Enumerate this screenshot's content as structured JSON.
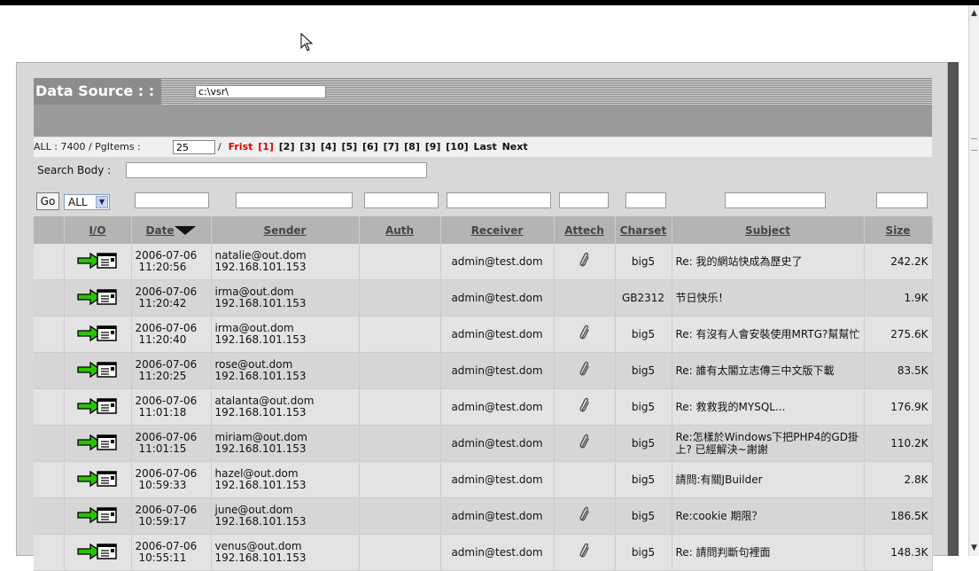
{
  "data_source": {
    "label": "Data Source : :",
    "path": "c:\\vsr\\"
  },
  "pagination": {
    "summary_prefix": "ALL : 7400 / PgItems :",
    "page_items": "25",
    "separator": "/",
    "first_label": "Frist",
    "current_page": "[1]",
    "pages": [
      "[2]",
      "[3]",
      "[4]",
      "[5]",
      "[6]",
      "[7]",
      "[8]",
      "[9]",
      "[10]"
    ],
    "last_label": "Last",
    "next_label": "Next"
  },
  "search": {
    "label": "Search Body :",
    "value": ""
  },
  "filters": {
    "go_label": "Go",
    "io_select": "ALL"
  },
  "columns": {
    "io": "I/O",
    "date": "Date",
    "sender": "Sender",
    "auth": "Auth",
    "receiver": "Receiver",
    "attach": "Attech",
    "charset": "Charset",
    "subject": "Subject",
    "size": "Size"
  },
  "rows": [
    {
      "date": "2006-07-06",
      "time": "11:20:56",
      "sender": "natalie@out.dom",
      "ip": "192.168.101.153",
      "auth": "",
      "receiver": "admin@test.dom",
      "attach": true,
      "charset": "big5",
      "subject": "Re: 我的網站快成為歷史了",
      "size": "242.2K"
    },
    {
      "date": "2006-07-06",
      "time": "11:20:42",
      "sender": "irma@out.dom",
      "ip": "192.168.101.153",
      "auth": "",
      "receiver": "admin@test.dom",
      "attach": false,
      "charset": "GB2312",
      "subject": "节日快乐！",
      "size": "1.9K"
    },
    {
      "date": "2006-07-06",
      "time": "11:20:40",
      "sender": "irma@out.dom",
      "ip": "192.168.101.153",
      "auth": "",
      "receiver": "admin@test.dom",
      "attach": true,
      "charset": "big5",
      "subject": "Re: 有沒有人會安裝使用MRTG?幫幫忙",
      "size": "275.6K"
    },
    {
      "date": "2006-07-06",
      "time": "11:20:25",
      "sender": "rose@out.dom",
      "ip": "192.168.101.153",
      "auth": "",
      "receiver": "admin@test.dom",
      "attach": true,
      "charset": "big5",
      "subject": "Re: 誰有太閣立志傳三中文版下載",
      "size": "83.5K"
    },
    {
      "date": "2006-07-06",
      "time": "11:01:18",
      "sender": "atalanta@out.dom",
      "ip": "192.168.101.153",
      "auth": "",
      "receiver": "admin@test.dom",
      "attach": true,
      "charset": "big5",
      "subject": "Re: 救救我的MYSQL...",
      "size": "176.9K"
    },
    {
      "date": "2006-07-06",
      "time": "11:01:15",
      "sender": "miriam@out.dom",
      "ip": "192.168.101.153",
      "auth": "",
      "receiver": "admin@test.dom",
      "attach": true,
      "charset": "big5",
      "subject": "Re:怎樣於Windows下把PHP4的GD掛上? 已經解決~謝謝",
      "size": "110.2K"
    },
    {
      "date": "2006-07-06",
      "time": "10:59:33",
      "sender": "hazel@out.dom",
      "ip": "192.168.101.153",
      "auth": "",
      "receiver": "admin@test.dom",
      "attach": false,
      "charset": "big5",
      "subject": "請問:有關JBuilder",
      "size": "2.8K"
    },
    {
      "date": "2006-07-06",
      "time": "10:59:17",
      "sender": "june@out.dom",
      "ip": "192.168.101.153",
      "auth": "",
      "receiver": "admin@test.dom",
      "attach": true,
      "charset": "big5",
      "subject": "Re:cookie 期限？",
      "size": "186.5K"
    },
    {
      "date": "2006-07-06",
      "time": "10:55:11",
      "sender": "venus@out.dom",
      "ip": "192.168.101.153",
      "auth": "",
      "receiver": "admin@test.dom",
      "attach": true,
      "charset": "big5",
      "subject": "Re: 請問判斷句裡面",
      "size": "148.3K"
    }
  ]
}
